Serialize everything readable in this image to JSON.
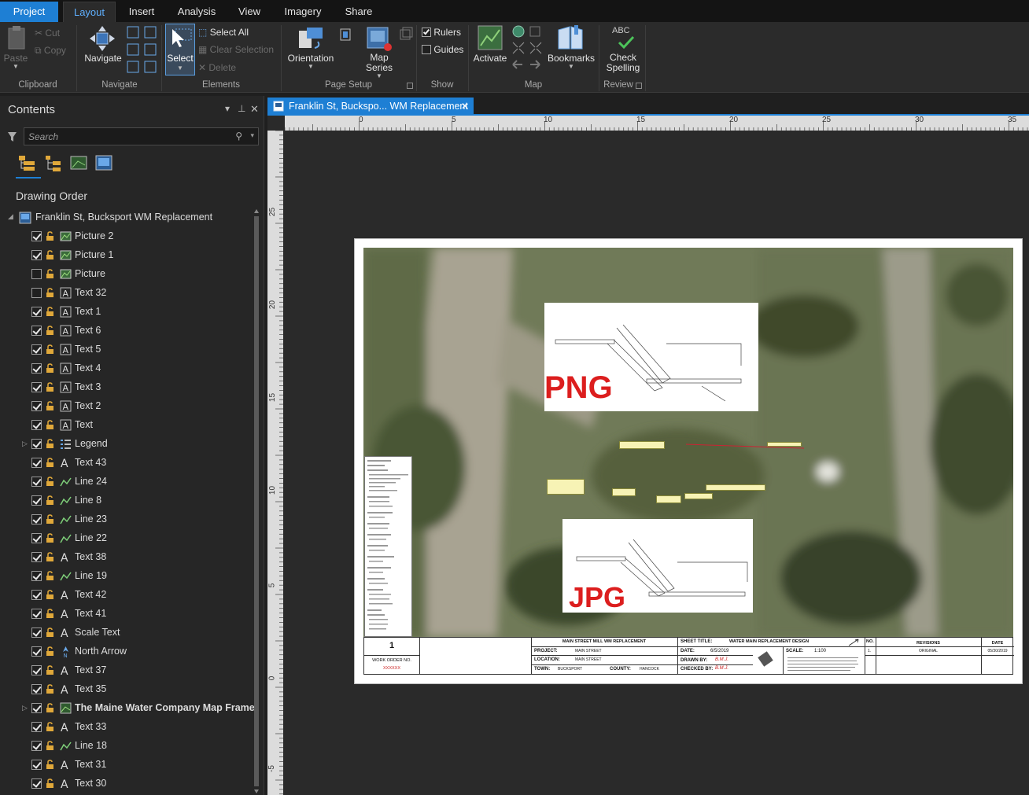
{
  "ribbon_tabs": [
    "Project",
    "Layout",
    "Insert",
    "Analysis",
    "View",
    "Imagery",
    "Share"
  ],
  "active_tab": "Layout",
  "ribbon": {
    "clipboard": {
      "label": "Clipboard",
      "paste": "Paste",
      "cut": "Cut",
      "copy": "Copy"
    },
    "navigate": {
      "label": "Navigate",
      "navigate_btn": "Navigate"
    },
    "elements": {
      "label": "Elements",
      "select": "Select",
      "select_all": "Select All",
      "clear_selection": "Clear Selection",
      "delete": "Delete"
    },
    "page_setup": {
      "label": "Page Setup",
      "orientation": "Orientation",
      "map_series_1": "Map",
      "map_series_2": "Series"
    },
    "show": {
      "label": "Show",
      "rulers": "Rulers",
      "rulers_checked": true,
      "guides": "Guides",
      "guides_checked": false
    },
    "map": {
      "label": "Map",
      "activate": "Activate",
      "bookmarks": "Bookmarks"
    },
    "review": {
      "label": "Review",
      "abc": "ABC",
      "check_1": "Check",
      "check_2": "Spelling"
    }
  },
  "contents": {
    "title": "Contents",
    "search_placeholder": "Search",
    "drawing_order": "Drawing Order",
    "root": "Franklin St, Bucksport WM Replacement",
    "items": [
      {
        "label": "Picture 2",
        "checked": true,
        "icon": "picture-icon"
      },
      {
        "label": "Picture 1",
        "checked": true,
        "icon": "picture-icon"
      },
      {
        "label": "Picture",
        "checked": false,
        "icon": "picture-icon"
      },
      {
        "label": "Text 32",
        "checked": false,
        "icon": "text-box-icon"
      },
      {
        "label": "Text 1",
        "checked": true,
        "icon": "text-box-icon"
      },
      {
        "label": "Text 6",
        "checked": true,
        "icon": "text-box-icon"
      },
      {
        "label": "Text 5",
        "checked": true,
        "icon": "text-box-icon"
      },
      {
        "label": "Text 4",
        "checked": true,
        "icon": "text-box-icon"
      },
      {
        "label": "Text 3",
        "checked": true,
        "icon": "text-box-icon"
      },
      {
        "label": "Text 2",
        "checked": true,
        "icon": "text-box-icon"
      },
      {
        "label": "Text",
        "checked": true,
        "icon": "text-box-icon"
      },
      {
        "label": "Legend",
        "checked": true,
        "icon": "legend-icon",
        "expandable": true
      },
      {
        "label": "Text 43",
        "checked": true,
        "icon": "text-icon"
      },
      {
        "label": "Line 24",
        "checked": true,
        "icon": "line-icon"
      },
      {
        "label": "Line 8",
        "checked": true,
        "icon": "line-icon"
      },
      {
        "label": "Line 23",
        "checked": true,
        "icon": "line-icon"
      },
      {
        "label": "Line 22",
        "checked": true,
        "icon": "line-icon"
      },
      {
        "label": "Text 38",
        "checked": true,
        "icon": "text-icon"
      },
      {
        "label": "Line 19",
        "checked": true,
        "icon": "line-icon"
      },
      {
        "label": "Text 42",
        "checked": true,
        "icon": "text-icon"
      },
      {
        "label": "Text 41",
        "checked": true,
        "icon": "text-icon"
      },
      {
        "label": "Scale Text",
        "checked": true,
        "icon": "text-icon"
      },
      {
        "label": "North Arrow",
        "checked": true,
        "icon": "north-arrow-icon"
      },
      {
        "label": "Text 37",
        "checked": true,
        "icon": "text-icon"
      },
      {
        "label": "Text 35",
        "checked": true,
        "icon": "text-icon"
      },
      {
        "label": "The Maine Water Company Map Frame",
        "checked": true,
        "icon": "map-frame-icon",
        "expandable": true,
        "bold": true
      },
      {
        "label": "Text 33",
        "checked": true,
        "icon": "text-icon"
      },
      {
        "label": "Line 18",
        "checked": true,
        "icon": "line-icon"
      },
      {
        "label": "Text 31",
        "checked": true,
        "icon": "text-icon"
      },
      {
        "label": "Text 30",
        "checked": true,
        "icon": "text-icon"
      }
    ]
  },
  "document_tab": "Franklin St, Buckspo... WM Replacement",
  "rulers": {
    "horizontal": [
      "0",
      "5",
      "10",
      "15",
      "20",
      "25",
      "30",
      "35"
    ],
    "vertical": [
      "25",
      "20",
      "15",
      "10",
      "5",
      "0",
      "-5"
    ]
  },
  "layout": {
    "png_label": "PNG",
    "jpg_label": "JPG",
    "title_block": {
      "sheet_number": "1",
      "work_order_label": "WORK ORDER NO.",
      "work_order_value": "XXXXXX",
      "project_title": "MAIN STREET MILL WM REPLACEMENT",
      "project_label": "PROJECT:",
      "project_value": "MAIN STREET",
      "location_label": "LOCATION:",
      "location_value": "MAIN STREET",
      "town_label": "TOWN:",
      "town_value": "BUCKSPORT",
      "county_label": "COUNTY:",
      "county_value": "HANCOCK",
      "sheet_title_label": "SHEET TITLE:",
      "sheet_title_value": "WATER MAIN REPLACEMENT DESIGN",
      "date_label": "DATE:",
      "date_value": "6/5/2019",
      "scale_label": "SCALE:",
      "scale_value": "1:100",
      "drawn_by_label": "DRAWN BY:",
      "drawn_by_value": "B.M.J.",
      "checked_by_label": "CHECKED BY:",
      "checked_by_value": "B.M.J.",
      "no_label": "NO.",
      "revisions_label": "REVISIONS",
      "rev_date_label": "DATE",
      "rev_no": "1.",
      "rev_desc": "ORIGINAL",
      "rev_date": "05/30/2019"
    }
  }
}
